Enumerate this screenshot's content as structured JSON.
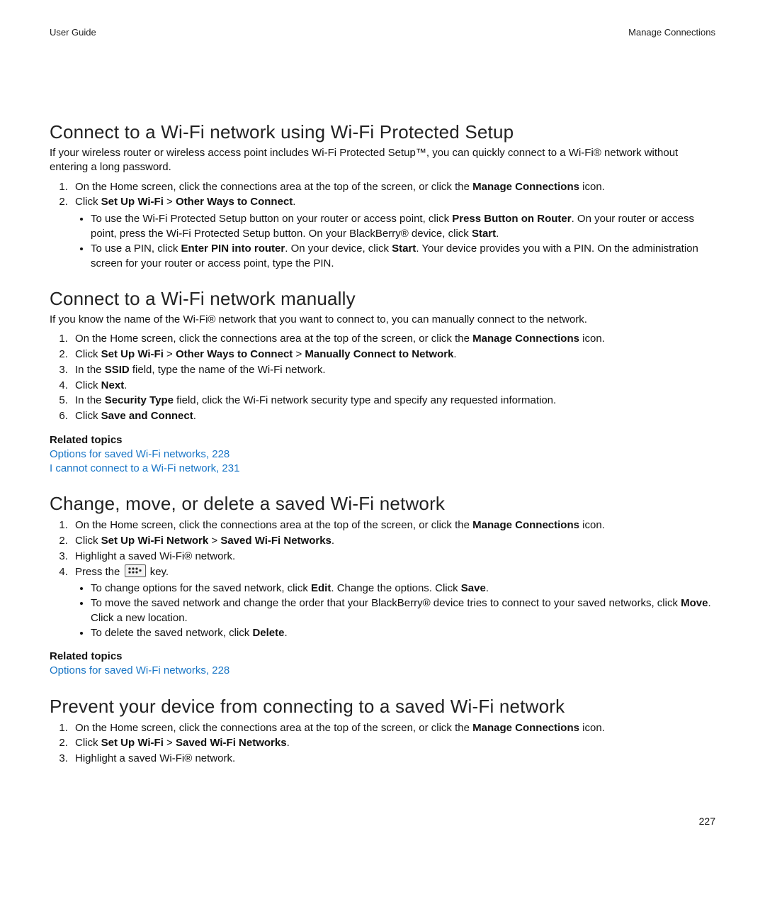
{
  "header": {
    "left": "User Guide",
    "right": "Manage Connections"
  },
  "page_number": "227",
  "s1": {
    "title": "Connect to a Wi-Fi network using Wi-Fi Protected Setup",
    "intro": "If your wireless router or wireless access point includes Wi-Fi Protected Setup™, you can quickly connect to a Wi-Fi® network without entering a long password.",
    "step1_a": "On the Home screen, click the connections area at the top of the screen, or click the ",
    "step1_b": "Manage Connections",
    "step1_c": " icon.",
    "step2_a": "Click ",
    "step2_b": "Set Up Wi-Fi",
    "step2_c": " > ",
    "step2_d": "Other Ways to Connect",
    "step2_e": ".",
    "b1_a": "To use the Wi-Fi Protected Setup button on your router or access point, click ",
    "b1_b": "Press Button on Router",
    "b1_c": ". On your router or access point, press the Wi-Fi Protected Setup button. On your BlackBerry® device, click ",
    "b1_d": "Start",
    "b1_e": ".",
    "b2_a": "To use a PIN, click ",
    "b2_b": "Enter PIN into router",
    "b2_c": ". On your device, click ",
    "b2_d": "Start",
    "b2_e": ". Your device provides you with a PIN. On the administration screen for your router or access point, type the PIN."
  },
  "s2": {
    "title": "Connect to a Wi-Fi network manually",
    "intro": "If you know the name of the Wi-Fi® network that you want to connect to, you can manually connect to the network.",
    "st1_a": "On the Home screen, click the connections area at the top of the screen, or click the ",
    "st1_b": "Manage Connections",
    "st1_c": " icon.",
    "st2_a": "Click ",
    "st2_b": "Set Up Wi-Fi",
    "st2_c": " > ",
    "st2_d": "Other Ways to Connect",
    "st2_e": " > ",
    "st2_f": "Manually Connect to Network",
    "st2_g": ".",
    "st3_a": "In the ",
    "st3_b": "SSID",
    "st3_c": " field, type the name of the Wi-Fi network.",
    "st4_a": "Click ",
    "st4_b": "Next",
    "st4_c": ".",
    "st5_a": "In the ",
    "st5_b": "Security Type",
    "st5_c": " field, click the Wi-Fi network security type and specify any requested information.",
    "st6_a": "Click ",
    "st6_b": "Save and Connect",
    "st6_c": ".",
    "related_h": "Related topics",
    "link1": "Options for saved Wi-Fi networks, 228",
    "link2": "I cannot connect to a Wi-Fi network, 231"
  },
  "s3": {
    "title": "Change, move, or delete a saved Wi-Fi network",
    "st1_a": "On the Home screen, click the connections area at the top of the screen, or click the ",
    "st1_b": "Manage Connections",
    "st1_c": " icon.",
    "st2_a": "Click ",
    "st2_b": "Set Up Wi-Fi Network",
    "st2_c": " > ",
    "st2_d": "Saved Wi-Fi Networks",
    "st2_e": ".",
    "st3": "Highlight a saved Wi-Fi® network.",
    "st4_a": "Press the ",
    "st4_b": " key.",
    "b1_a": "To change options for the saved network, click ",
    "b1_b": "Edit",
    "b1_c": ". Change the options. Click ",
    "b1_d": "Save",
    "b1_e": ".",
    "b2_a": "To move the saved network and change the order that your BlackBerry® device tries to connect to your saved networks, click ",
    "b2_b": "Move",
    "b2_c": ". Click a new location.",
    "b3_a": "To delete the saved network, click ",
    "b3_b": "Delete",
    "b3_c": ".",
    "related_h": "Related topics",
    "link1": "Options for saved Wi-Fi networks, 228"
  },
  "s4": {
    "title": "Prevent your device from connecting to a saved Wi-Fi network",
    "st1_a": "On the Home screen, click the connections area at the top of the screen, or click the ",
    "st1_b": "Manage Connections",
    "st1_c": " icon.",
    "st2_a": "Click ",
    "st2_b": "Set Up Wi-Fi",
    "st2_c": " > ",
    "st2_d": "Saved Wi-Fi Networks",
    "st2_e": ".",
    "st3": "Highlight a saved Wi-Fi® network."
  }
}
